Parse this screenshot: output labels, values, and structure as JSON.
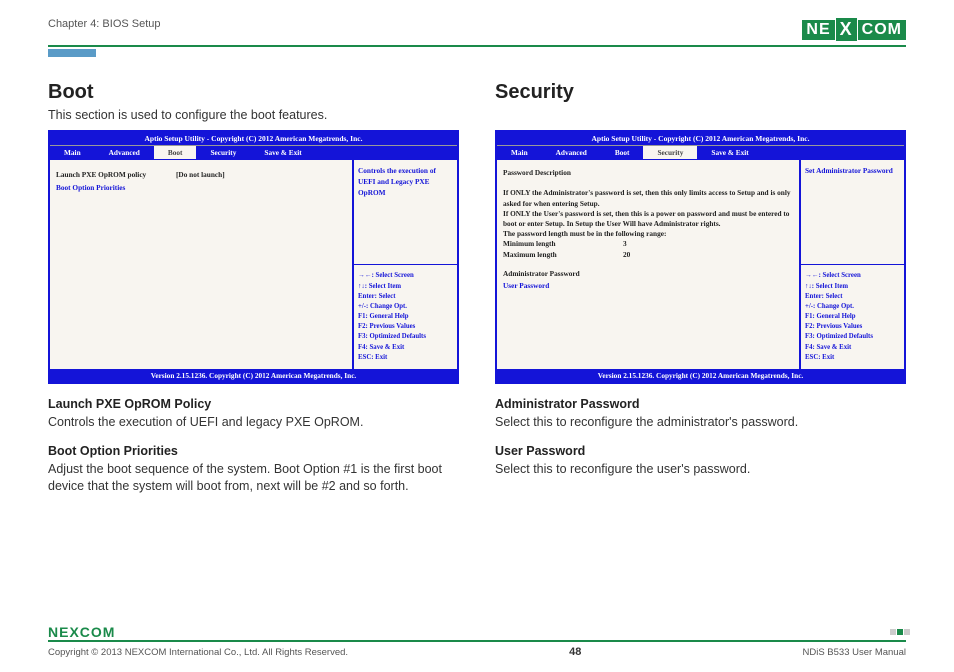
{
  "header": {
    "chapter": "Chapter 4: BIOS Setup",
    "logo": {
      "part1": "NE",
      "x": "X",
      "part2": "COM"
    }
  },
  "boot": {
    "title": "Boot",
    "intro": "This section is used to configure the boot features.",
    "bios": {
      "title": "Aptio Setup Utility - Copyright (C) 2012 American Megatrends, Inc.",
      "tabs": {
        "main": "Main",
        "advanced": "Advanced",
        "boot": "Boot",
        "security": "Security",
        "save": "Save & Exit"
      },
      "opt1_label": "Launch PXE OpROM policy",
      "opt1_value": "[Do not launch]",
      "opt2_label": "Boot Option Priorities",
      "help": "Controls the execution of UEFI and Legacy PXE OpROM",
      "keys": {
        "k1": "→←: Select Screen",
        "k2": "↑↓: Select Item",
        "k3": "Enter: Select",
        "k4": "+/-: Change Opt.",
        "k5": "F1: General Help",
        "k6": "F2: Previous Values",
        "k7": "F3: Optimized Defaults",
        "k8": "F4: Save & Exit",
        "k9": "ESC: Exit"
      },
      "footer": "Version 2.15.1236. Copyright (C) 2012 American Megatrends, Inc."
    },
    "desc1_title": "Launch PXE OpROM Policy",
    "desc1_body": "Controls the execution of UEFI and legacy PXE OpROM.",
    "desc2_title": "Boot Option Priorities",
    "desc2_body": "Adjust the boot sequence of the system. Boot Option #1 is the first boot device that the system will boot from, next will be #2 and so forth."
  },
  "security": {
    "title": "Security",
    "bios": {
      "title": "Aptio Setup Utility - Copyright (C) 2012 American Megatrends, Inc.",
      "tabs": {
        "main": "Main",
        "advanced": "Advanced",
        "boot": "Boot",
        "security": "Security",
        "save": "Save & Exit"
      },
      "pw_heading": "Password Description",
      "pw_body1": "If ONLY the Administrator's password is set, then this only limits access to Setup and is only asked for when entering Setup.",
      "pw_body2": "If ONLY the User's password is set, then this is a power on password and must be entered to boot or enter Setup. In Setup the User Will have Administrator rights.",
      "pw_body3": "The password length must be in the following range:",
      "min_label": "Minimum length",
      "min_val": "3",
      "max_label": "Maximum length",
      "max_val": "20",
      "item_admin": "Administrator Password",
      "item_user": "User Password",
      "help": "Set Administrator Password",
      "keys": {
        "k1": "→←: Select Screen",
        "k2": "↑↓: Select Item",
        "k3": "Enter: Select",
        "k4": "+/-: Change Opt.",
        "k5": "F1: General Help",
        "k6": "F2: Previous Values",
        "k7": "F3: Optimized Defaults",
        "k8": "F4: Save & Exit",
        "k9": "ESC: Exit"
      },
      "footer": "Version 2.15.1236. Copyright (C) 2012 American Megatrends, Inc."
    },
    "desc1_title": "Administrator Password",
    "desc1_body": "Select this to reconfigure the administrator's password.",
    "desc2_title": "User Password",
    "desc2_body": "Select this to reconfigure the user's password."
  },
  "footer": {
    "logo": "NEXCOM",
    "copyright": "Copyright © 2013 NEXCOM International Co., Ltd. All Rights Reserved.",
    "page": "48",
    "doc": "NDiS B533 User Manual"
  }
}
